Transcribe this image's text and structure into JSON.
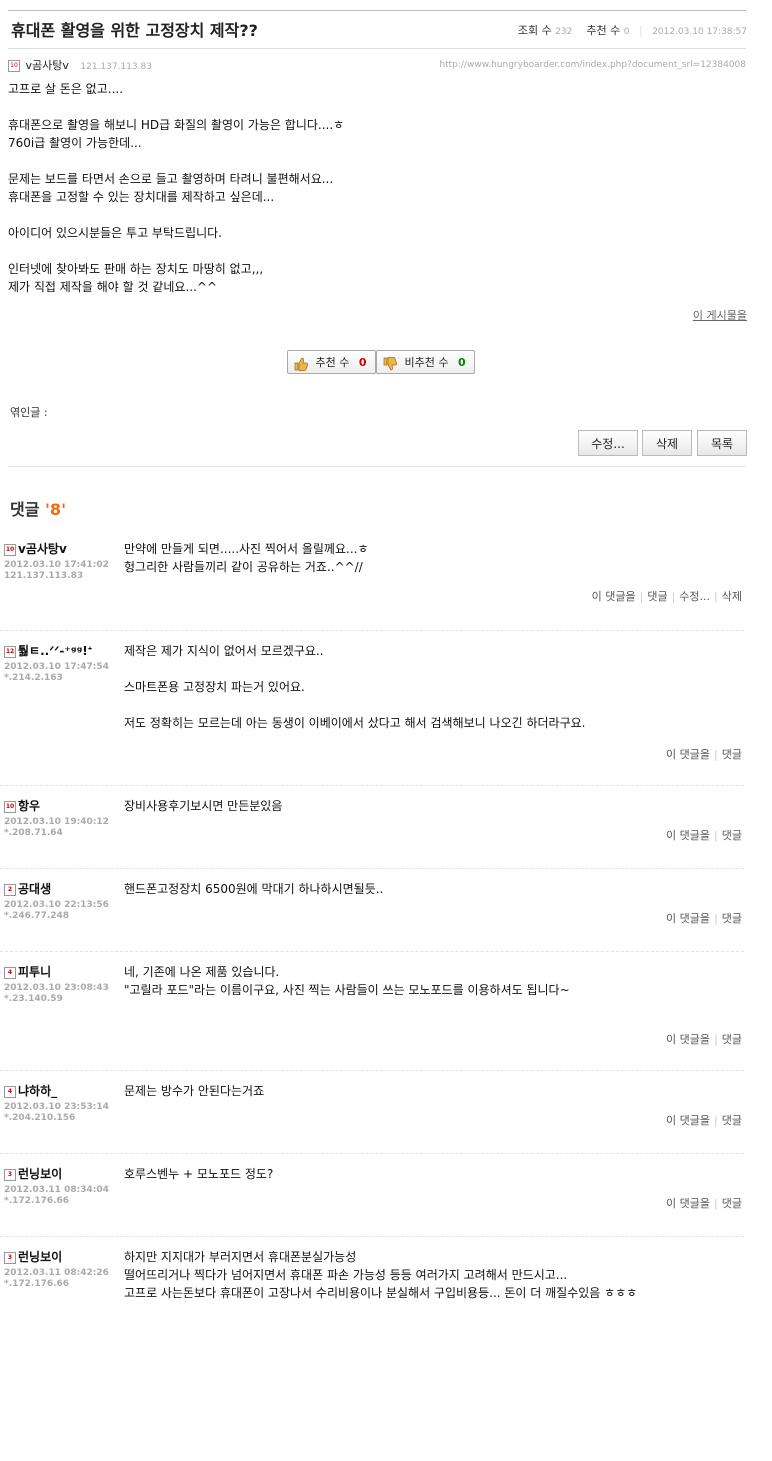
{
  "post": {
    "title": "휴대폰 활영을 위한 고정장치 제작??",
    "views_label": "조회 수",
    "views": "232",
    "recommend_label": "추천 수",
    "recommend": "0",
    "datetime": "2012.03.10 17:38:57",
    "author": "v곰사탕v",
    "author_level": "10",
    "ip": "121.137.113.83",
    "url": "http://www.hungryboarder.com/index.php?document_srl=12384008",
    "body": [
      "고프로 살 돈은 없고....",
      "",
      "휴대폰으로 촬영을 해보니 HD급 화질의 촬영이 가능은 합니다....ㅎ",
      "760i급 촬영이 가능한데...",
      "",
      "문제는 보드를 타면서 손으로 들고 촬영하며 타려니 불편해서요...",
      "휴대폰을 고정할 수 있는 장치대를 제작하고 싶은데...",
      "",
      "아이디어 있으시분들은 투고 부탁드립니다.",
      "",
      "인터넷에 찾아봐도 판매 하는 장치도 마땅히 없고,,,",
      "제가 직접 제작을 해야 할 것 같네요...^^"
    ],
    "board_link": "이 게시물을",
    "recommend_button": {
      "label": "추천 수",
      "count": "0"
    },
    "disrecommend_button": {
      "label": "비추천 수",
      "count": "0"
    },
    "trackback_label": "엮인글 :",
    "edit_button": "수정...",
    "delete_button": "삭제",
    "list_button": "목록"
  },
  "comments_header": {
    "label": "댓글",
    "count": "'8'"
  },
  "comments": [
    {
      "author": "v곰사탕v",
      "level": "10",
      "date": "2012.03.10 17:41:02",
      "ip": "121.137.113.83",
      "text": "만약에 만들게 되면.....사진 찍어서 올릴께요...ㅎ\n헝그리한 사람들끼리 같이 공유하는 거죠..^^//",
      "actions": [
        "이 댓글을",
        "댓글",
        "수정...",
        "삭제"
      ]
    },
    {
      "author": "퉗ㅌ..ᐟᐟ-⁺ᵍᵍ!ᐩ",
      "level": "12",
      "date": "2012.03.10 17:47:54",
      "ip": "*.214.2.163",
      "text": "제작은 제가 지식이 없어서 모르겠구요..\n\n스마트폰용 고정장치 파는거 있어요.\n\n저도 정확히는 모르는데 아는 동생이 이베이에서 샀다고 해서 검색해보니 나오긴 하더라구요.",
      "actions": [
        "이 댓글을",
        "댓글"
      ]
    },
    {
      "author": "항우",
      "level": "10",
      "date": "2012.03.10 19:40:12",
      "ip": "*.208.71.64",
      "text": "장비사용후기보시면 만든분있음",
      "actions": [
        "이 댓글을",
        "댓글"
      ]
    },
    {
      "author": "공대생",
      "level": "2",
      "date": "2012.03.10 22:13:56",
      "ip": "*.246.77.248",
      "text": "핸드폰고정장치 6500원에 막대기 하나하시면될듯..",
      "actions": [
        "이 댓글을",
        "댓글"
      ]
    },
    {
      "author": "피투니",
      "level": "4",
      "date": "2012.03.10 23:08:43",
      "ip": "*.23.140.59",
      "text": "네, 기존에 나온 제품 있습니다.\n\"고릴라 포드\"라는 이름이구요, 사진 찍는 사람들이 쓰는 모노포드를 이용하셔도 됩니다~",
      "actions": [
        "이 댓글을",
        "댓글"
      ]
    },
    {
      "author": "냐하하_",
      "level": "4",
      "date": "2012.03.10 23:53:14",
      "ip": "*.204.210.156",
      "text": "문제는 방수가 안된다는거죠",
      "actions": [
        "이 댓글을",
        "댓글"
      ]
    },
    {
      "author": "런닝보이",
      "level": "3",
      "date": "2012.03.11 08:34:04",
      "ip": "*.172.176.66",
      "text": "호루스벤누 + 모노포드 정도?",
      "actions": [
        "이 댓글을",
        "댓글"
      ]
    },
    {
      "author": "런닝보이",
      "level": "3",
      "date": "2012.03.11 08:42:26",
      "ip": "*.172.176.66",
      "text": "하지만 지지대가 부러지면서 휴대폰분실가능성\n떨어뜨리거나 찍다가 넘어지면서 휴대폰 파손 가능성 등등 여러가지 고려해서 만드시고...\n고프로 사는돈보다 휴대폰이 고장나서 수리비용이나 분실해서 구입비용등... 돈이 더 깨질수있음 ㅎㅎㅎ",
      "actions": []
    }
  ]
}
